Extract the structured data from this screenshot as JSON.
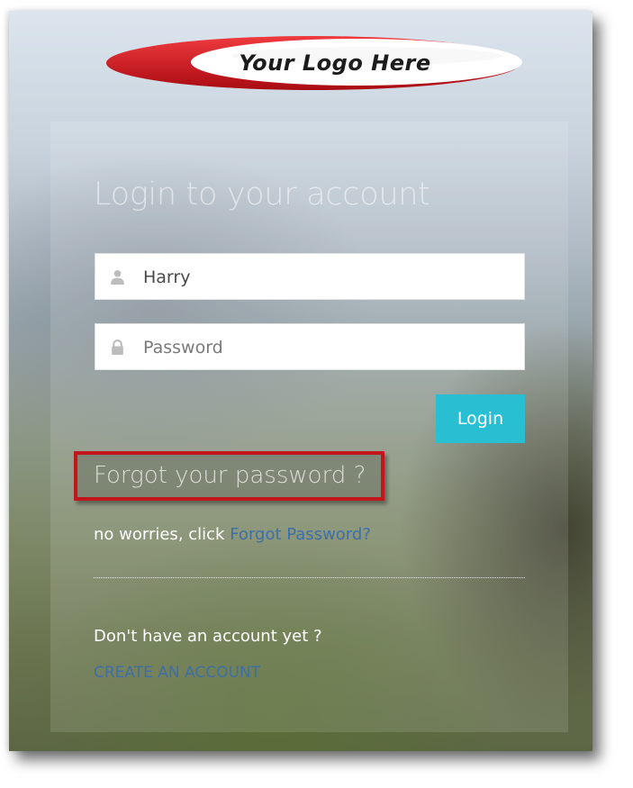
{
  "logo": {
    "text": "Your Logo Here",
    "ring_color": "#d4121a"
  },
  "login": {
    "title": "Login to your account",
    "username": {
      "value": "Harry",
      "icon": "user-icon"
    },
    "password": {
      "placeholder": "Password",
      "icon": "lock-icon"
    },
    "button_label": "Login",
    "button_color": "#29bfd3"
  },
  "forgot": {
    "title": "Forgot your password ?",
    "prompt": "no worries, click",
    "link_label": "Forgot Password?",
    "highlight_color": "#c0161c"
  },
  "signup": {
    "prompt": "Don't have an account yet ?",
    "link_label": "CREATE AN ACCOUNT"
  },
  "colors": {
    "link": "#3d6fa6"
  }
}
